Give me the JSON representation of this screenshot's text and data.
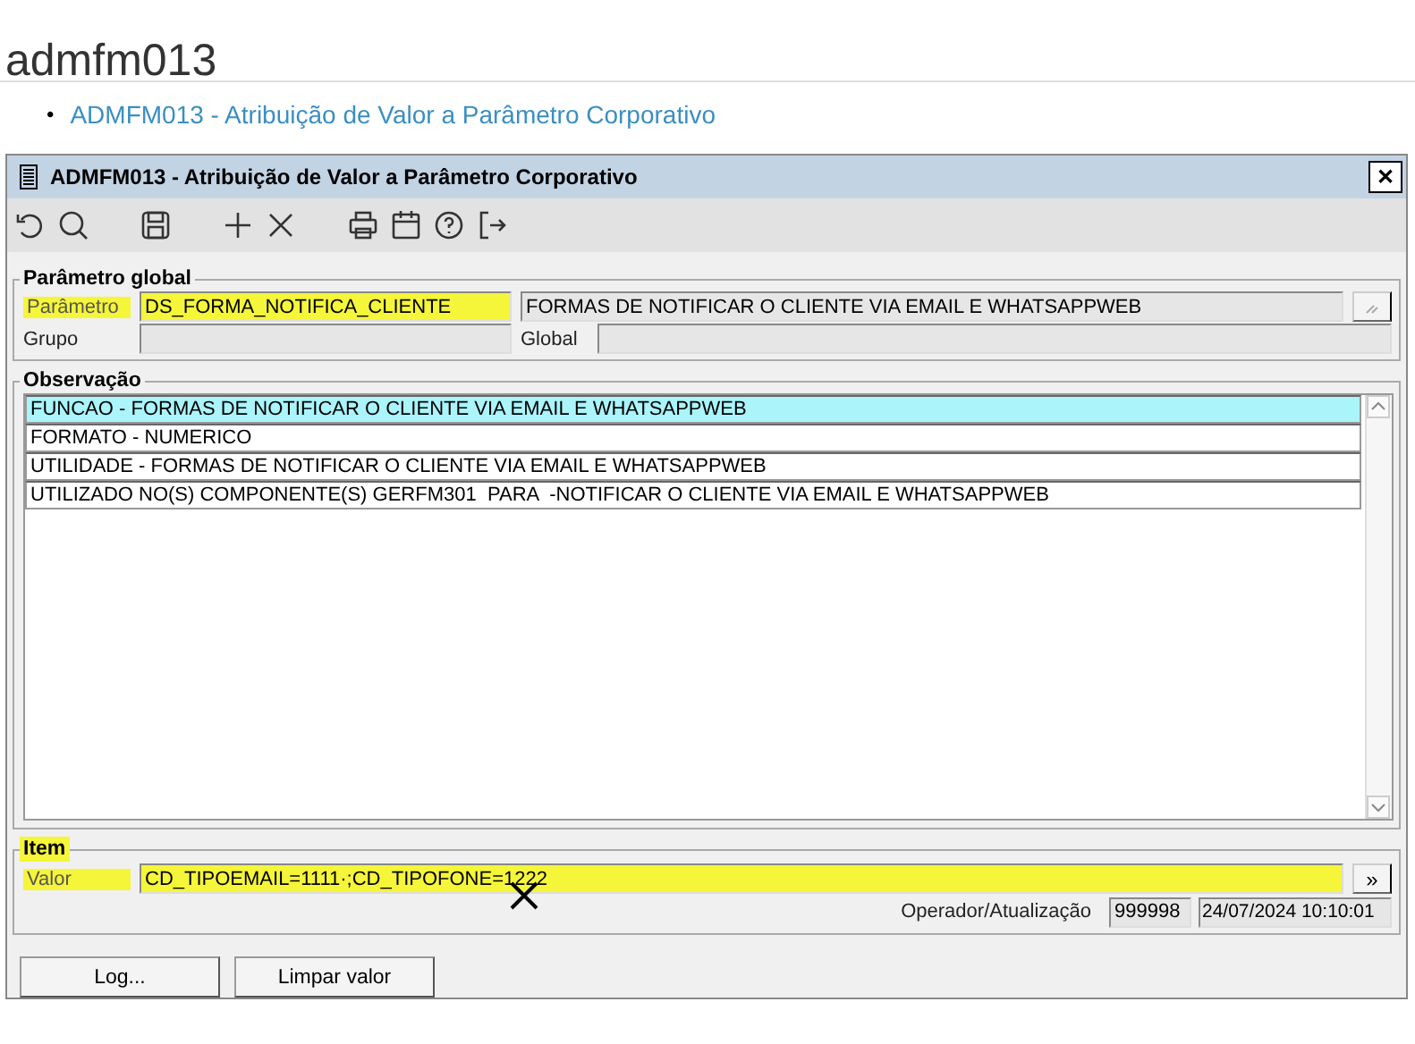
{
  "page": {
    "title": "admfm013",
    "links": [
      {
        "bullet": "•",
        "text": "ADMFM013 - Atribuição de Valor a Parâmetro Corporativo"
      }
    ]
  },
  "window": {
    "title": "ADMFM013 - Atribuição de Valor a Parâmetro Corporativo",
    "close": "✕"
  },
  "parametro_global": {
    "legend": "Parâmetro global",
    "parametro": {
      "label": "Parâmetro",
      "value": "DS_FORMA_NOTIFICA_CLIENTE",
      "highlighted": true
    },
    "descricao": {
      "value": "FORMAS DE NOTIFICAR O CLIENTE VIA EMAIL E WHATSAPPWEB"
    },
    "grupo": {
      "label": "Grupo"
    },
    "global": {
      "label": "Global"
    }
  },
  "observacao": {
    "legend": "Observação",
    "rows": [
      {
        "text": "FUNCAO - FORMAS DE NOTIFICAR O CLIENTE VIA EMAIL E WHATSAPPWEB",
        "selected": true
      },
      {
        "text": "FORMATO - NUMERICO",
        "selected": false
      },
      {
        "text": "UTILIDADE - FORMAS DE NOTIFICAR O CLIENTE VIA EMAIL E WHATSAPPWEB",
        "selected": false
      },
      {
        "text": "UTILIZADO NO(S) COMPONENTE(S) GERFM301  PARA  -NOTIFICAR O CLIENTE VIA EMAIL E WHATSAPPWEB",
        "selected": false
      }
    ]
  },
  "item": {
    "legend": "Item",
    "valor": {
      "label": "Valor",
      "value": "CD_TIPOEMAIL=1111·;CD_TIPOFONE=1222",
      "highlighted": true
    },
    "expand_button": "»",
    "operador": {
      "label": "Operador/Atualização",
      "code": "999998",
      "date": "24/07/2024 10:10:01"
    }
  },
  "buttons": [
    "Log...",
    "Limpar valor"
  ]
}
